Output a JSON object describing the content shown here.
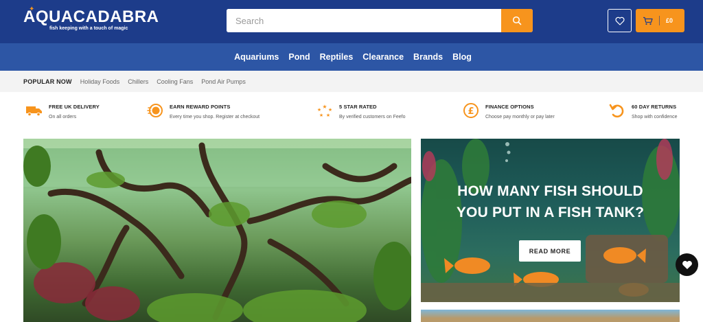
{
  "brand": {
    "name": "AQUACADABRA",
    "tagline": "fish keeping with a touch of magic",
    "colors": {
      "primary": "#1d3c8a",
      "nav": "#2d56a5",
      "accent": "#f7941d"
    }
  },
  "search": {
    "placeholder": "Search",
    "value": ""
  },
  "header": {
    "wishlist_icon": "heart-icon",
    "cart_icon": "cart-icon",
    "cart_total": "£0"
  },
  "nav": {
    "items": [
      "Aquariums",
      "Pond",
      "Reptiles",
      "Clearance",
      "Brands",
      "Blog"
    ]
  },
  "popular": {
    "title": "POPULAR NOW",
    "items": [
      "Holiday Foods",
      "Chillers",
      "Cooling Fans",
      "Pond Air Pumps"
    ]
  },
  "usps": [
    {
      "icon": "delivery-truck-icon",
      "title": "FREE UK DELIVERY",
      "subtitle": "On all orders"
    },
    {
      "icon": "reward-coins-icon",
      "title": "EARN REWARD POINTS",
      "subtitle": "Every time you shop. Register at checkout"
    },
    {
      "icon": "stars-icon",
      "title": "5 STAR RATED",
      "subtitle": "By verified customers on Feefo"
    },
    {
      "icon": "pound-icon",
      "title": "FINANCE OPTIONS",
      "subtitle": "Choose pay monthly or pay later"
    },
    {
      "icon": "returns-icon",
      "title": "60 DAY RETURNS",
      "subtitle": "Shop with confidence"
    }
  ],
  "hero": {
    "right_title_line1": "HOW MANY FISH SHOULD",
    "right_title_line2": "YOU PUT IN A FISH TANK?",
    "cta": "READ MORE"
  },
  "floating": {
    "icon": "heart-icon"
  }
}
